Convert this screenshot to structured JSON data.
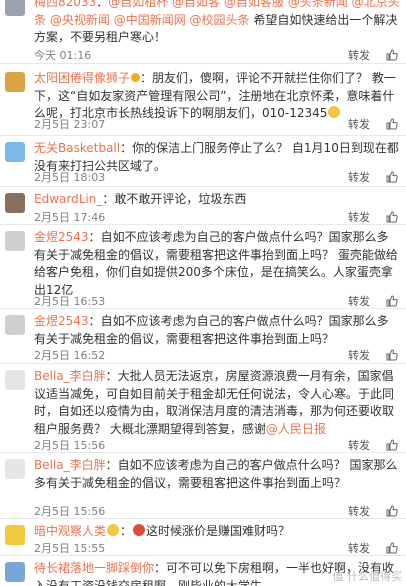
{
  "actions": {
    "repost_label": "转发",
    "like_icon": "thumbs-up-icon"
  },
  "comments": [
    {
      "username": "梅西82033",
      "colon": "：",
      "mentions": [
        "@自如租杯",
        "@自如客",
        "@自如客服",
        "@头条新闻",
        "@北京头条",
        "@央视新闻",
        "@中国新闻网",
        "@校园头条"
      ],
      "text": "希望自如快速给出一个解决方案，不要另租户寒心！",
      "time": "今天 01:16",
      "avatar_color": "#9aa3ad"
    },
    {
      "username": "太阳困倦得像狮子",
      "colon": "：",
      "text_a": "朋友们，傻啊，评论不开就拦住你们了？ 教一下，这“自如友家资产管理有限公司”，注册地在北京怀柔，意味着什么呢，打北京市长热线投诉下的啊朋友们，010-12345",
      "time": "2月5日 23:07",
      "avatar_color": "#d9a441"
    },
    {
      "username": "无关Basketball",
      "colon": "：",
      "text_a": "你的保洁上门服务停止了么？ 自1月10日到现在都没有来打扫公共区域了。",
      "time": "2月5日 18:03",
      "avatar_color": "#7cb9e8"
    },
    {
      "username": "EdwardLin_",
      "colon": "：",
      "text_a": "敢不敢开评论，垃圾东西",
      "time": "2月5日 17:46",
      "avatar_color": "#8a6f5c"
    },
    {
      "username": "金煜2543",
      "colon": "：",
      "text_a": "自如不应该考虑为自己的客户做点什么吗？国家那么多有关于减免租金的倡议，需要租客把这件事抬到面上吗？ 蛋壳能做给给客户免租，你们自如提供200多个床位，是在搞笑么。人家蛋壳拿出12亿",
      "time": "2月5日 16:53",
      "avatar_color": "#cfcfcf"
    },
    {
      "username": "金煜2543",
      "colon": "：",
      "text_a": "自如不应该考虑为自己的客户做点什么吗？国家那么多有关于减免租金的倡议，需要租客把这件事抬到面上吗？",
      "time": "2月5日 16:52",
      "avatar_color": "#cfcfcf"
    },
    {
      "username": "Bella_李白胖",
      "colon": "：",
      "text_a": "大批人员无法返京，房屋资源浪费一月有余，国家倡议适当减免，可自如目前关于租金却无任何说法，令人心寒。于此同时，自如还以疫情为由，取消保洁月度的清洁消毒，那为何还要收取租户服务费？ 大概北漂期望得到答复，感谢",
      "mention_tail": "@人民日报",
      "time": "2月5日 15:56",
      "avatar_color": "#e6e6e6"
    },
    {
      "username": "Bella_李白胖",
      "colon": "：",
      "text_a": "自如不应该考虑为自己的客户做点什么吗？ 国家那么多有关于减免租金的倡议，需要租客把这件事抬到面上吗？",
      "time": "2月5日 15:56",
      "avatar_color": "#e6e6e6"
    },
    {
      "username": "暗中观察人类",
      "colon": "：",
      "text_a": "这时候涨价是赚国难财吗？",
      "time": "2月5日 15:55",
      "avatar_color": "#f3c93f"
    },
    {
      "username": "待长裙落地一脚踩倒你",
      "colon": "：",
      "text_a": "可不可以免下房租啊，一半也好啊，没有收入没有工资没钱交房租啊，刚毕业的大学生。",
      "time": "",
      "avatar_color": "#7aa6d6"
    }
  ],
  "watermark": "值 什么值得买"
}
